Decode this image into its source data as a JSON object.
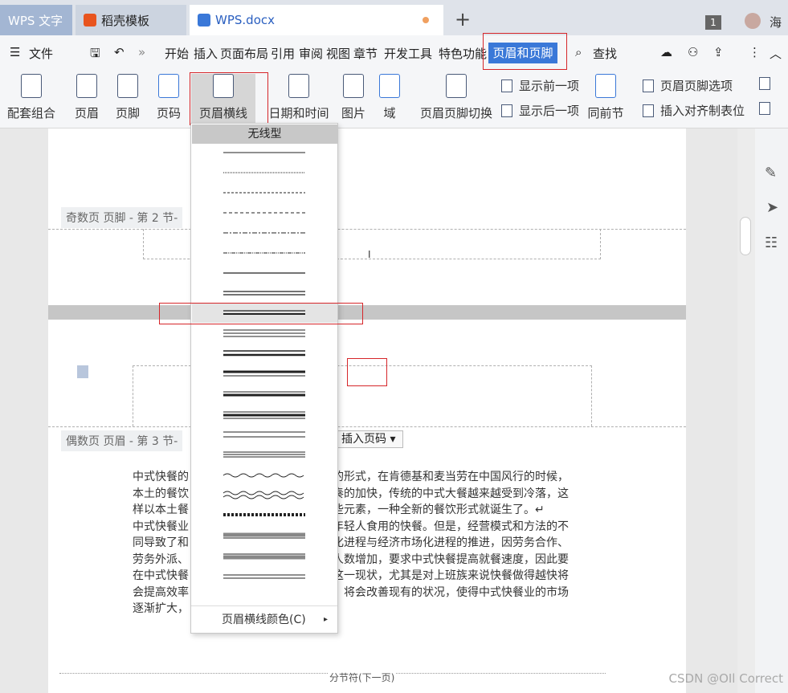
{
  "tabs": {
    "app": "WPS 文字",
    "template": "稻壳模板",
    "doc": "WPS.docx"
  },
  "window": {
    "badge": "1",
    "user": "海"
  },
  "menu": {
    "file": "文件",
    "items": [
      "开始",
      "插入",
      "页面布局",
      "引用",
      "审阅",
      "视图",
      "章节",
      "开发工具",
      "特色功能"
    ],
    "active": "页眉和页脚",
    "search": "查找"
  },
  "ribbon": {
    "combo": "配套组合",
    "header": "页眉",
    "footer": "页脚",
    "pagenum": "页码",
    "hline": "页眉横线",
    "datetime": "日期和时间",
    "picture": "图片",
    "field": "域",
    "switch": "页眉页脚切换",
    "show_prev": "显示前一项",
    "show_next": "显示后一项",
    "same_prev": "同前节",
    "options": "页眉页脚选项",
    "insert_tab": "插入对齐制表位"
  },
  "doc": {
    "odd_footer_label": "奇数页 页脚  - 第 2 节-",
    "even_header_label": "偶数页 页眉  - 第 3 节-",
    "insert_pagenum": "插入页码",
    "paragraphs": [
      "中式快餐的",
      "化的形式，在肯德基和麦当劳在中国风行的时候，",
      "本土的餐饮",
      "节奏的加快，传统的中式大餐越来越受到冷落，这",
      "样以本土餐",
      "某些元素，一种全新的餐饮形式就诞生了。↵",
      "中式快餐业",
      "合年轻人食用的快餐。但是，经营模式和方法的不",
      "同导致了和",
      "示化进程与经济市场化进程的推进，因劳务合作、",
      "劳务外派、",
      "国人数增加，要求中式快餐提高就餐速度，因此要",
      "在中式快餐",
      "变这一现状，尤其是对上班族来说快餐做得越快将",
      "会提高效率",
      "后，将会改善现有的状况，使得中式快餐业的市场",
      "逐渐扩大，"
    ],
    "section_break": "分节符(下一页)"
  },
  "dropdown": {
    "title": "无线型",
    "footer": "页眉横线颜色(C)"
  },
  "watermark": "CSDN @OIl Correct"
}
